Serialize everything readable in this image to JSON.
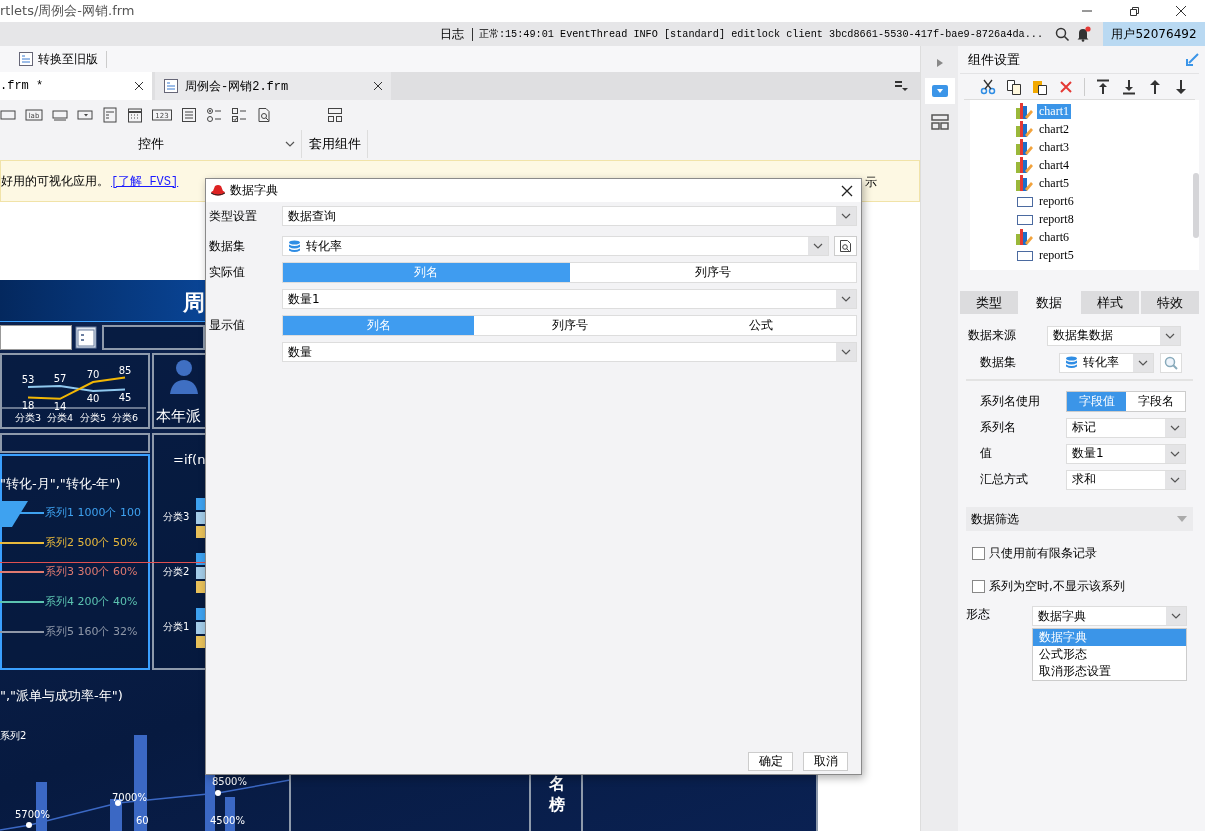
{
  "window": {
    "title": "rtlets/周例会-网销.frm"
  },
  "status_bar": {
    "log_label": "日志",
    "log_message": "正常:15:49:01 EventThread INFO [standard] editlock client 3bcd8661-5530-417f-bae9-8726a4da...",
    "user": "用户52076492"
  },
  "toolbar": {
    "switch_button": "转换至旧版"
  },
  "tabs": [
    {
      "label": ".frm *",
      "selected": true
    },
    {
      "label": "周例会-网销2.frm",
      "selected": false
    }
  ],
  "ribbon": {
    "label_icon_text": "lab",
    "number_icon_text": "123",
    "groups": [
      "控件",
      "套用组件"
    ]
  },
  "notice": {
    "text": "好用的可视化应用。",
    "link": "[了解 FVS]",
    "close_text": "示"
  },
  "dashboard": {
    "banner_title": "周",
    "line_chart": {
      "chart_data": {
        "type": "line",
        "categories": [
          "分类3",
          "分类4",
          "分类5",
          "分类6"
        ],
        "data_labels": true,
        "series": [
          {
            "color": "#8fc8ee",
            "values": [
              53,
              57,
              40,
              45
            ]
          },
          {
            "color": "#f2b705",
            "values": [
              18,
              14,
              70,
              85
            ]
          }
        ]
      }
    },
    "avatar_caption": "本年派",
    "funnel": {
      "title": "\"转化-月\",\"转化-年\")",
      "legend": [
        {
          "label": "系列1 1000个 100",
          "color": "#3ea2f0"
        },
        {
          "label": "系列2 500个 50%",
          "color": "#e8b93c"
        },
        {
          "label": "系列3 300个 60%",
          "color": "#e07a70"
        },
        {
          "label": "系列4 200个 40%",
          "color": "#5cc3b0"
        },
        {
          "label": "系列5 160个 32%",
          "color": "#8f98a8"
        }
      ]
    },
    "bar_panel": {
      "formula": "=if(n",
      "categories": [
        "分类3",
        "分类2",
        "分类1"
      ]
    },
    "bottom_chart": {
      "title": "\",\"派单与成功率-年\")",
      "series_label": "系列2",
      "labels": [
        "5700%",
        "7000%",
        "60",
        "8500%",
        "4500%"
      ]
    },
    "rank_title": "名榜"
  },
  "dialog": {
    "title": "数据字典",
    "type_label": "类型设置",
    "type_value": "数据查询",
    "dataset_label": "数据集",
    "dataset_value": "转化率",
    "actual_label": "实际值",
    "actual_modes": [
      {
        "label": "列名",
        "selected": true
      },
      {
        "label": "列序号",
        "selected": false
      }
    ],
    "actual_value": "数量1",
    "display_label": "显示值",
    "display_modes": [
      {
        "label": "列名",
        "selected": true
      },
      {
        "label": "列序号",
        "selected": false
      },
      {
        "label": "公式",
        "selected": false
      }
    ],
    "display_value": "数量",
    "buttons": [
      "确定",
      "取消"
    ]
  },
  "side_panel": {
    "title": "组件设置",
    "components": [
      {
        "name": "chart1",
        "kind": "chart",
        "selected": true
      },
      {
        "name": "chart2",
        "kind": "chart",
        "selected": false
      },
      {
        "name": "chart3",
        "kind": "chart",
        "selected": false
      },
      {
        "name": "chart4",
        "kind": "chart",
        "selected": false
      },
      {
        "name": "chart5",
        "kind": "chart",
        "selected": false
      },
      {
        "name": "report6",
        "kind": "report",
        "selected": false
      },
      {
        "name": "report8",
        "kind": "report",
        "selected": false
      },
      {
        "name": "chart6",
        "kind": "chart",
        "selected": false
      },
      {
        "name": "report5",
        "kind": "report",
        "selected": false
      }
    ],
    "tabs": [
      {
        "label": "类型",
        "selected": false
      },
      {
        "label": "数据",
        "selected": true
      },
      {
        "label": "样式",
        "selected": false
      },
      {
        "label": "特效",
        "selected": false
      }
    ],
    "source": {
      "label": "数据来源",
      "value": "数据集数据"
    },
    "dataset": {
      "label": "数据集",
      "value": "转化率"
    },
    "series_name_mode": {
      "label": "系列名使用",
      "options": [
        {
          "label": "字段值",
          "selected": true
        },
        {
          "label": "字段名",
          "selected": false
        }
      ]
    },
    "mapping": [
      {
        "label": "系列名",
        "value": "标记"
      },
      {
        "label": "值",
        "value": "数量1"
      },
      {
        "label": "汇总方式",
        "value": "求和"
      }
    ],
    "filter_title": "数据筛选",
    "options": [
      {
        "label": "只使用前有限条记录",
        "checked": false
      },
      {
        "label": "系列为空时,不显示该系列",
        "checked": false
      }
    ],
    "form": {
      "label": "形态",
      "value": "数据字典",
      "menu": [
        {
          "label": "数据字典",
          "selected": true
        },
        {
          "label": "公式形态",
          "selected": false
        },
        {
          "label": "取消形态设置",
          "selected": false
        }
      ]
    }
  }
}
